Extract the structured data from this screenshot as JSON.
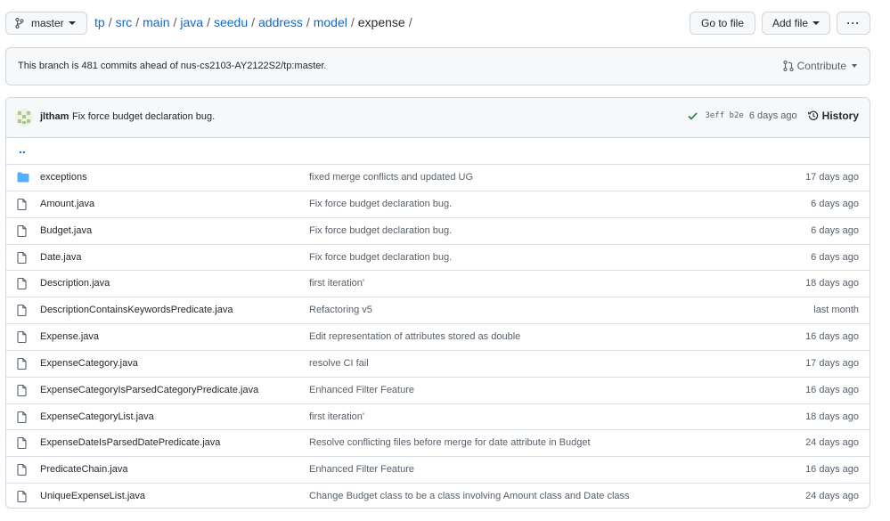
{
  "branch": {
    "name": "master"
  },
  "breadcrumb": {
    "items": [
      "tp",
      "src",
      "main",
      "java",
      "seedu",
      "address",
      "model"
    ],
    "current": "expense",
    "separator": "/"
  },
  "actions": {
    "goto_file": "Go to file",
    "add_file": "Add file",
    "more": "···"
  },
  "ahead_banner": {
    "text": "This branch is 481 commits ahead of nus-cs2103-AY2122S2/tp:master.",
    "contribute": "Contribute"
  },
  "latest_commit": {
    "author": "jltham",
    "message": "Fix force budget declaration bug.",
    "sha": "3eff b2e",
    "age": "6 days ago",
    "history_label": "History"
  },
  "parent_dir": "..",
  "files": [
    {
      "name": "exceptions",
      "type": "dir",
      "message": "fixed merge conflicts and updated UG",
      "age": "17 days ago"
    },
    {
      "name": "Amount.java",
      "type": "file",
      "message": "Fix force budget declaration bug.",
      "age": "6 days ago"
    },
    {
      "name": "Budget.java",
      "type": "file",
      "message": "Fix force budget declaration bug.",
      "age": "6 days ago"
    },
    {
      "name": "Date.java",
      "type": "file",
      "message": "Fix force budget declaration bug.",
      "age": "6 days ago"
    },
    {
      "name": "Description.java",
      "type": "file",
      "message": "first iteration'",
      "age": "18 days ago"
    },
    {
      "name": "DescriptionContainsKeywordsPredicate.java",
      "type": "file",
      "message": "Refactoring v5",
      "age": "last month"
    },
    {
      "name": "Expense.java",
      "type": "file",
      "message": "Edit representation of attributes stored as double",
      "age": "16 days ago"
    },
    {
      "name": "ExpenseCategory.java",
      "type": "file",
      "message": "resolve CI fail",
      "age": "17 days ago"
    },
    {
      "name": "ExpenseCategoryIsParsedCategoryPredicate.java",
      "type": "file",
      "message": "Enhanced Filter Feature",
      "age": "16 days ago"
    },
    {
      "name": "ExpenseCategoryList.java",
      "type": "file",
      "message": "first iteration'",
      "age": "18 days ago"
    },
    {
      "name": "ExpenseDateIsParsedDatePredicate.java",
      "type": "file",
      "message": "Resolve conflicting files before merge for date attribute in Budget",
      "age": "24 days ago"
    },
    {
      "name": "PredicateChain.java",
      "type": "file",
      "message": "Enhanced Filter Feature",
      "age": "16 days ago"
    },
    {
      "name": "UniqueExpenseList.java",
      "type": "file",
      "message": "Change Budget class to be a class involving Amount class and Date class",
      "age": "24 days ago"
    }
  ],
  "colors": {
    "link": "#0969da",
    "folder": "#54aeff",
    "success": "#1a7f37",
    "border": "#d0d7de",
    "muted": "#57606a"
  }
}
